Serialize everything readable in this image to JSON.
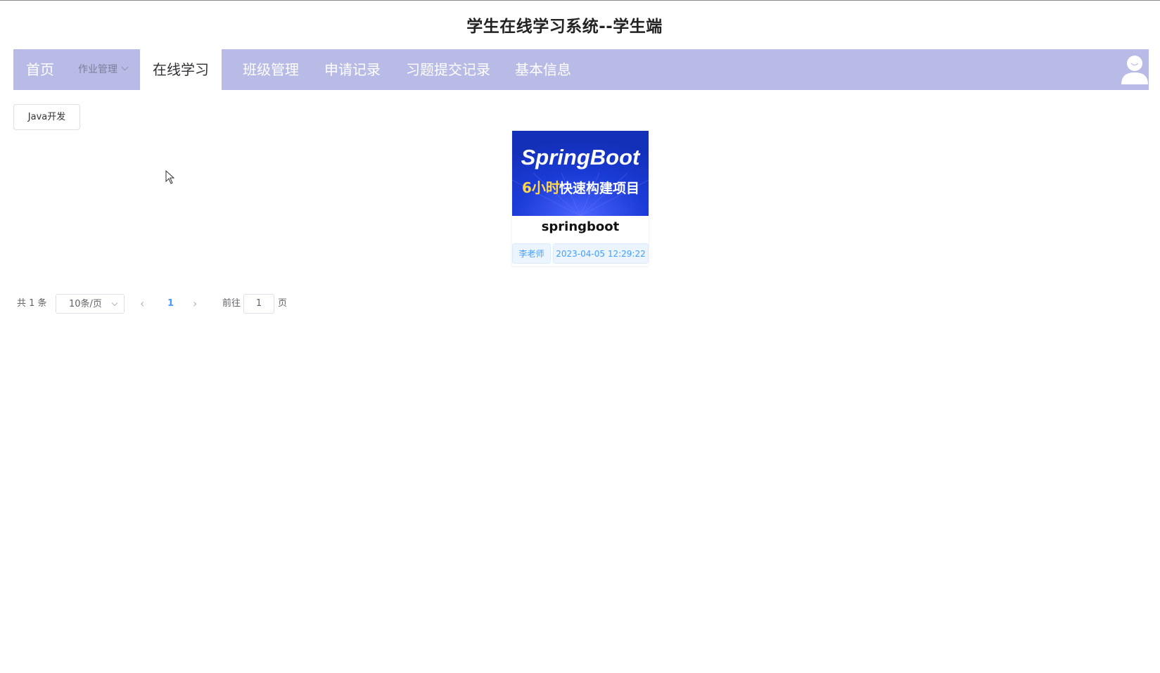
{
  "app": {
    "title": "学生在线学习系统--学生端"
  },
  "nav": {
    "items": [
      {
        "label": "首页"
      },
      {
        "label": "作业管理"
      },
      {
        "label": "在线学习"
      },
      {
        "label": "班级管理"
      },
      {
        "label": "申请记录"
      },
      {
        "label": "习题提交记录"
      },
      {
        "label": "基本信息"
      }
    ],
    "active": "在线学习",
    "avatar_icon": "user-avatar-icon"
  },
  "category": {
    "label": "Java开发"
  },
  "courses": [
    {
      "banner_title": "SpringBoot",
      "banner_highlight": "6小时",
      "banner_subtitle": "快速构建项目",
      "name": "springboot",
      "teacher": "李老师",
      "time": "2023-04-05 12:29:22"
    }
  ],
  "pagination": {
    "total_text": "共 1 条",
    "page_size": "10条/页",
    "current_page": "1",
    "goto_label": "前往",
    "goto_value": "1",
    "page_unit": "页"
  },
  "colors": {
    "nav_bg": "#b7bbe6",
    "accent": "#409eff",
    "banner_bg": "#1637c9"
  }
}
